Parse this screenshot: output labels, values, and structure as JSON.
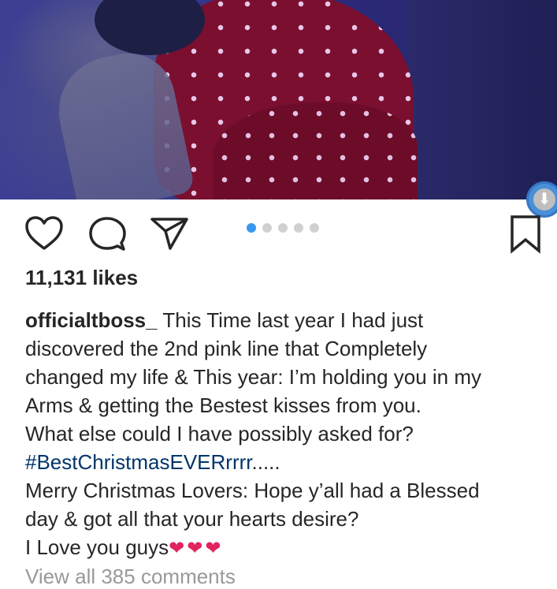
{
  "post": {
    "likes_text": "11,131 likes",
    "username": "officialtboss_",
    "caption_lines": [
      "This Time last year I had just",
      "discovered the 2nd pink line that Completely",
      "changed my life & This year: I’m holding you in my",
      "Arms & getting the Bestest kisses from you.",
      "What else could I have possibly asked for?"
    ],
    "hashtag": "#BestChristmasEVERrrrr",
    "hashtag_suffix": ".....",
    "caption_after": [
      "Merry Christmas Lovers: Hope y’all had a Blessed",
      "day & got all that your hearts desire?"
    ],
    "closing_text": "I Love you guys",
    "closing_emoji": "❤❤❤",
    "view_all_text": "View all 385 comments"
  },
  "carousel": {
    "total": 5,
    "active_index": 0
  },
  "icons": [
    "heart-icon",
    "comment-icon",
    "share-icon",
    "bookmark-icon",
    "download-icon"
  ],
  "colors": {
    "active_dot": "#3897f0",
    "inactive_dot": "#d0d0d0",
    "hashtag": "#003569",
    "heart_emoji": "#e0245e",
    "download": "#4a90d9"
  }
}
